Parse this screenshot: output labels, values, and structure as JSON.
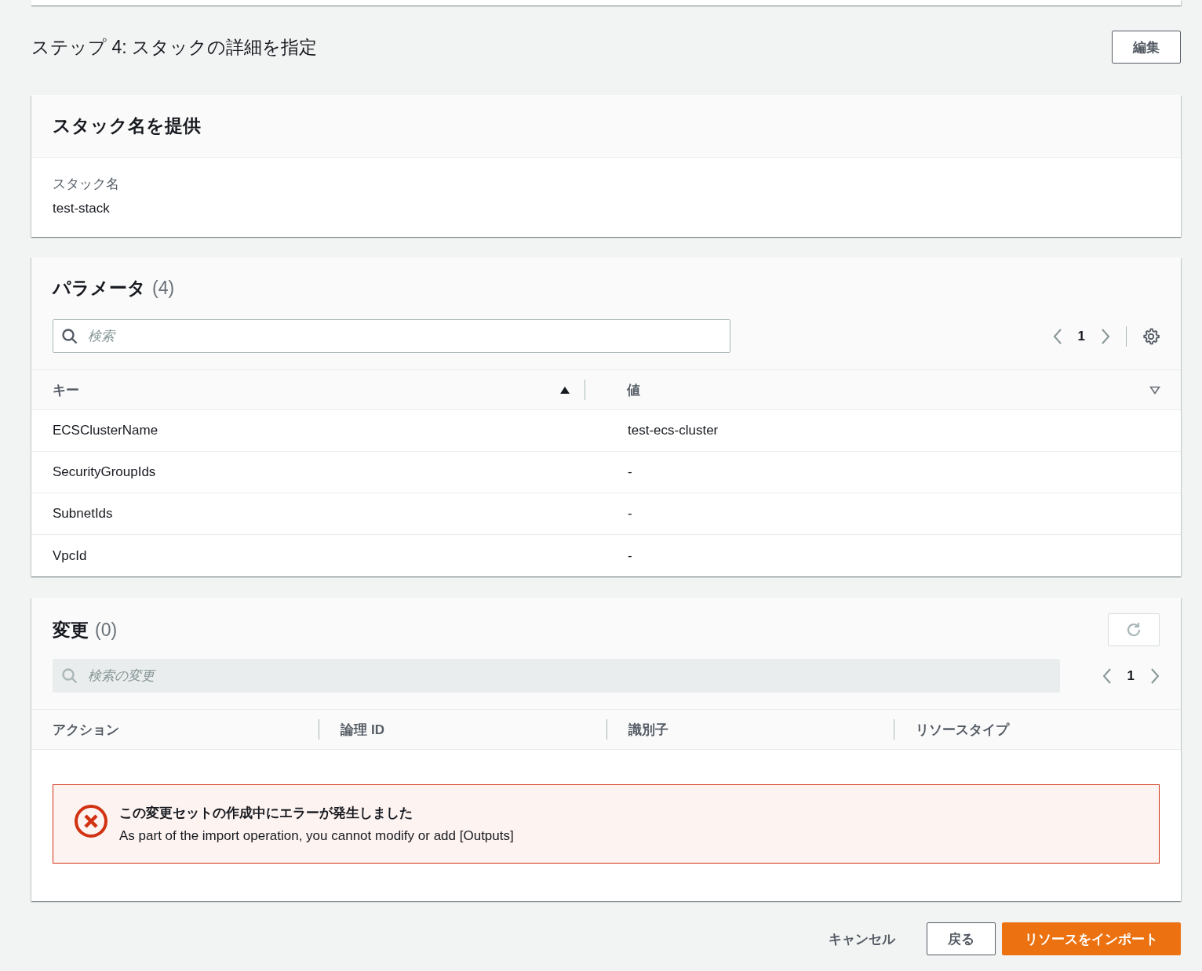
{
  "step": {
    "title": "ステップ 4: スタックの詳細を指定",
    "edit_button": "編集"
  },
  "stack_name_card": {
    "title": "スタック名を提供",
    "label": "スタック名",
    "value": "test-stack"
  },
  "parameters": {
    "title": "パラメータ",
    "count": "(4)",
    "search": {
      "placeholder": "検索"
    },
    "page": "1",
    "columns": [
      {
        "label": "キー",
        "sorted": true
      },
      {
        "label": "値",
        "sorted": false
      }
    ],
    "rows": [
      {
        "key": "ECSClusterName",
        "value": "test-ecs-cluster"
      },
      {
        "key": "SecurityGroupIds",
        "value": "-"
      },
      {
        "key": "SubnetIds",
        "value": "-"
      },
      {
        "key": "VpcId",
        "value": "-"
      }
    ]
  },
  "changes": {
    "title": "変更",
    "count": "(0)",
    "search": {
      "placeholder": "検索の変更",
      "disabled": true
    },
    "page": "1",
    "columns": [
      "アクション",
      "論理 ID",
      "識別子",
      "リソースタイプ"
    ],
    "error": {
      "title": "この変更セットの作成中にエラーが発生しました",
      "message": "As part of the import operation, you cannot modify or add [Outputs]"
    }
  },
  "footer": {
    "cancel": "キャンセル",
    "back": "戻る",
    "submit": "リソースをインポート"
  }
}
